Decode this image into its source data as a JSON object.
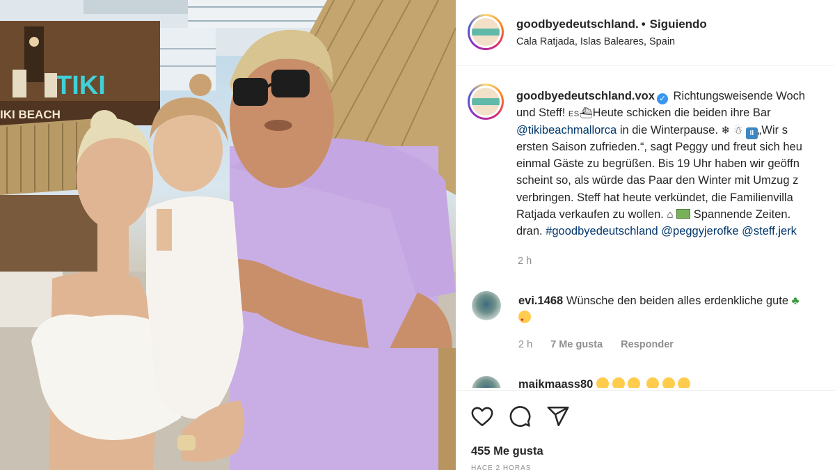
{
  "photo": {
    "sign_text": "TIKI",
    "sign_subtext": "IKI BEACH"
  },
  "post_header": {
    "username": "goodbyedeutschland.",
    "separator": "•",
    "follow_label": "Siguiendo",
    "location": "Cala Ratjada, Islas Baleares, Spain"
  },
  "caption": {
    "username": "goodbyedeutschland.vox",
    "verified_mark": "✓",
    "line1_text": " Richtungsweisende Woch",
    "line2_a": "und Steff! ",
    "line2_badge": "ES",
    "line2_b": "Heute schicken die beiden ihre Bar",
    "line3_mention": "@tikibeachmallorca",
    "line3_text": " in die Winterpause. ",
    "line3_pause": "II",
    "line3_end": "„Wir s",
    "line4": "ersten Saison zufrieden.“, sagt Peggy und freut sich heu",
    "line5": "einmal Gäste zu begrüßen. Bis 19 Uhr haben wir geöffn",
    "line6": "scheint so, als würde das Paar den Winter mit Umzug z",
    "line7": "verbringen. Steff hat heute verkündet, die Familienvilla",
    "line8_a": "Ratjada verkaufen zu wollen. ",
    "line8_b": " Spannende Zeiten.",
    "line9_a": "dran. ",
    "line9_hashtag": "#goodbyedeutschland",
    "line9_mention1": "@peggyjerofke",
    "line9_mention2": "@steff.jerk",
    "time": "2 h"
  },
  "comments": [
    {
      "username": "evi.1468",
      "text": " Wünsche den beiden alles erdenkliche gute ",
      "time": "2 h",
      "likes": "7 Me gusta",
      "reply_label": "Responder"
    },
    {
      "username": "maikmaass80"
    }
  ],
  "actions": {
    "likes_count": "455 Me gusta",
    "ago": "HACE 2 HORAS"
  },
  "icons": {
    "like": "heart-icon",
    "comment": "comment-icon",
    "share": "paper-plane-icon",
    "verified": "verified-badge-icon"
  },
  "colors": {
    "link": "#00376b",
    "verified": "#3897f0",
    "secondary_text": "#8e8e8e",
    "border": "#efefef"
  }
}
